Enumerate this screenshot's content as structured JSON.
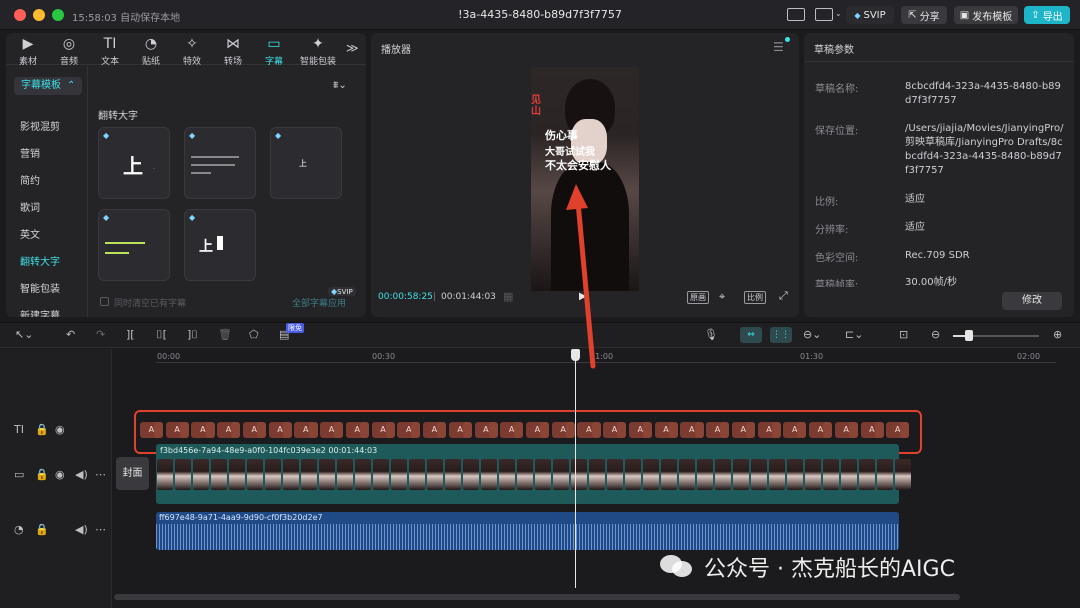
{
  "titlebar": {
    "time_status": "15:58:03 自动保存本地",
    "project_title": "!3a-4435-8480-b89d7f3f7757",
    "svip": "SVIP",
    "share": "分享",
    "publish_template": "发布模板",
    "export": "导出"
  },
  "toolbar": {
    "items": [
      "素材",
      "音频",
      "文本",
      "贴纸",
      "特效",
      "转场",
      "字幕",
      "智能包装"
    ],
    "active": "字幕",
    "more": "≫"
  },
  "categories": {
    "selected": "字幕模板",
    "items": [
      "影视混剪",
      "营销",
      "简约",
      "歌词",
      "英文",
      "翻转大字",
      "智能包装",
      "新建字幕"
    ],
    "active": "翻转大字"
  },
  "library": {
    "section_title": "翻转大字",
    "card_texts": [
      "上",
      "上",
      "上"
    ],
    "clear_checkbox": "同时清空已有字幕",
    "apply_all": "全部字幕应用",
    "svip_badge": "SVIP"
  },
  "player": {
    "title": "播放器",
    "current_time": "00:00:58:25",
    "total_time": "00:01:44:03",
    "original_label": "原画",
    "ratio_label": "比例",
    "subtitles": [
      "伤心事",
      "大哥试试我",
      "不太会安慰人"
    ],
    "vertical_text": "见山"
  },
  "draft": {
    "title": "草稿参数",
    "name_label": "草稿名称:",
    "name_value": "8cbcdfd4-323a-4435-8480-b89d7f3f7757",
    "location_label": "保存位置:",
    "location_value": "/Users/jiajia/Movies/JianyingPro/剪映草稿库/JianyingPro Drafts/8cbcdfd4-323a-4435-8480-b89d7f3f7757",
    "ratio_label": "比例:",
    "ratio_value": "适应",
    "resolution_label": "分辨率:",
    "resolution_value": "适应",
    "colorspace_label": "色彩空间:",
    "colorspace_value": "Rec.709 SDR",
    "fps_label": "草稿帧率:",
    "fps_value": "30.00帧/秒",
    "modify_button": "修改"
  },
  "timeline": {
    "limited_free": "限免",
    "ruler": [
      "00:00",
      "00:30",
      "01:00",
      "01:30",
      "02:00"
    ],
    "video_clip_label": "f3bd456e-7a94-48e9-a0f0-104fc039e3e2   00:01:44:03",
    "audio_clip_label": "ff697e48-9a71-4aa9-9d90-cf0f3b20d2e7",
    "cover_label": "封面",
    "subtitle_chip_labels": [
      "A",
      "A",
      "A",
      "A",
      "A",
      "A",
      "A",
      "A",
      "A",
      "A",
      "A",
      "A",
      "A",
      "A",
      "A",
      "A",
      "A",
      "A",
      "A",
      "A",
      "A",
      "A",
      "A",
      "A",
      "A",
      "A",
      "A",
      "A",
      "A",
      "A"
    ]
  },
  "watermark": {
    "text": "公众号 · 杰克船长的AIGC"
  },
  "colors": {
    "accent": "#3ee0e6",
    "subtitle_chip": "#7c3b30",
    "highlight_box": "#e0412d",
    "video_track": "#1f5a5a",
    "audio_track": "#1f4a86"
  }
}
